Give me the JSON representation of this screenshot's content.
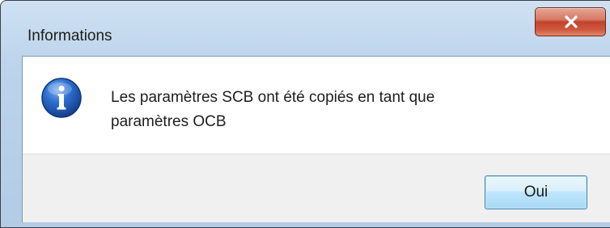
{
  "window": {
    "title": "Informations",
    "close_icon": "close-x-icon"
  },
  "message": {
    "icon": "info-icon",
    "line1": "Les paramètres SCB ont été copiés en tant que",
    "line2": "paramètres OCB"
  },
  "buttons": {
    "ok_label": "Oui"
  },
  "colors": {
    "close_button": "#c7432d",
    "info_icon": "#1f5fbf",
    "footer_bg": "#f0f0f0"
  }
}
